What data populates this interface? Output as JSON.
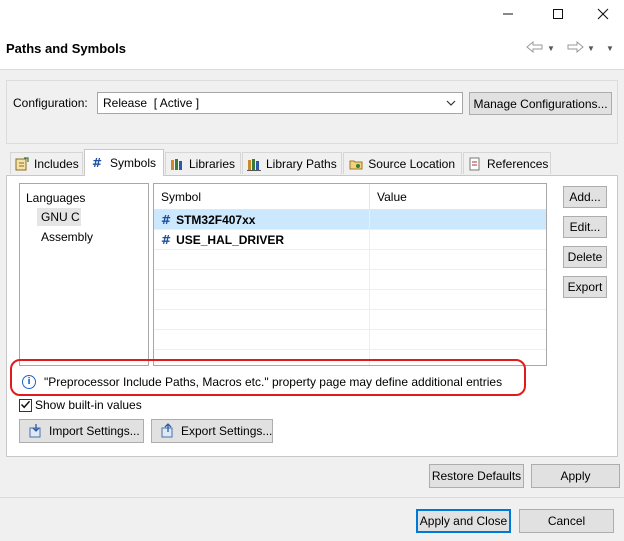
{
  "window": {
    "minimize_glyph": "—",
    "maximize_glyph": "☐",
    "close_glyph": "✕"
  },
  "header": {
    "title": "Paths and Symbols",
    "back_icon": "back-arrow-icon",
    "forward_icon": "forward-arrow-icon"
  },
  "configuration": {
    "label": "Configuration:",
    "value": "Release  [ Active ]",
    "manage_label": "Manage Configurations..."
  },
  "tabs": [
    {
      "label": "Includes",
      "icon": "includes-icon"
    },
    {
      "label": "Symbols",
      "icon": "hash-icon",
      "active": true
    },
    {
      "label": "Libraries",
      "icon": "libraries-icon"
    },
    {
      "label": "Library Paths",
      "icon": "library-paths-icon"
    },
    {
      "label": "Source Location",
      "icon": "source-location-icon"
    },
    {
      "label": "References",
      "icon": "references-icon"
    }
  ],
  "languages": {
    "header": "Languages",
    "items": [
      "GNU C",
      "Assembly"
    ],
    "selected": "GNU C"
  },
  "symbols_table": {
    "columns": [
      "Symbol",
      "Value"
    ],
    "rows": [
      {
        "symbol": "STM32F407xx",
        "value": "",
        "selected": true
      },
      {
        "symbol": "USE_HAL_DRIVER",
        "value": "",
        "selected": false
      }
    ],
    "hash_glyph": "#"
  },
  "side_buttons": {
    "add": "Add...",
    "edit": "Edit...",
    "delete": "Delete",
    "export": "Export"
  },
  "info_message": "\"Preprocessor Include Paths, Macros etc.\" property page may define additional entries",
  "show_builtin": {
    "label": "Show built-in values",
    "checked": true
  },
  "import_settings": "Import Settings...",
  "export_settings": "Export Settings...",
  "footer": {
    "restore_defaults": "Restore Defaults",
    "apply": "Apply",
    "apply_and_close": "Apply and Close",
    "cancel": "Cancel"
  },
  "colors": {
    "selection": "#cce8ff",
    "accent": "#0078d7",
    "highlight_oval": "#e01b1b"
  }
}
